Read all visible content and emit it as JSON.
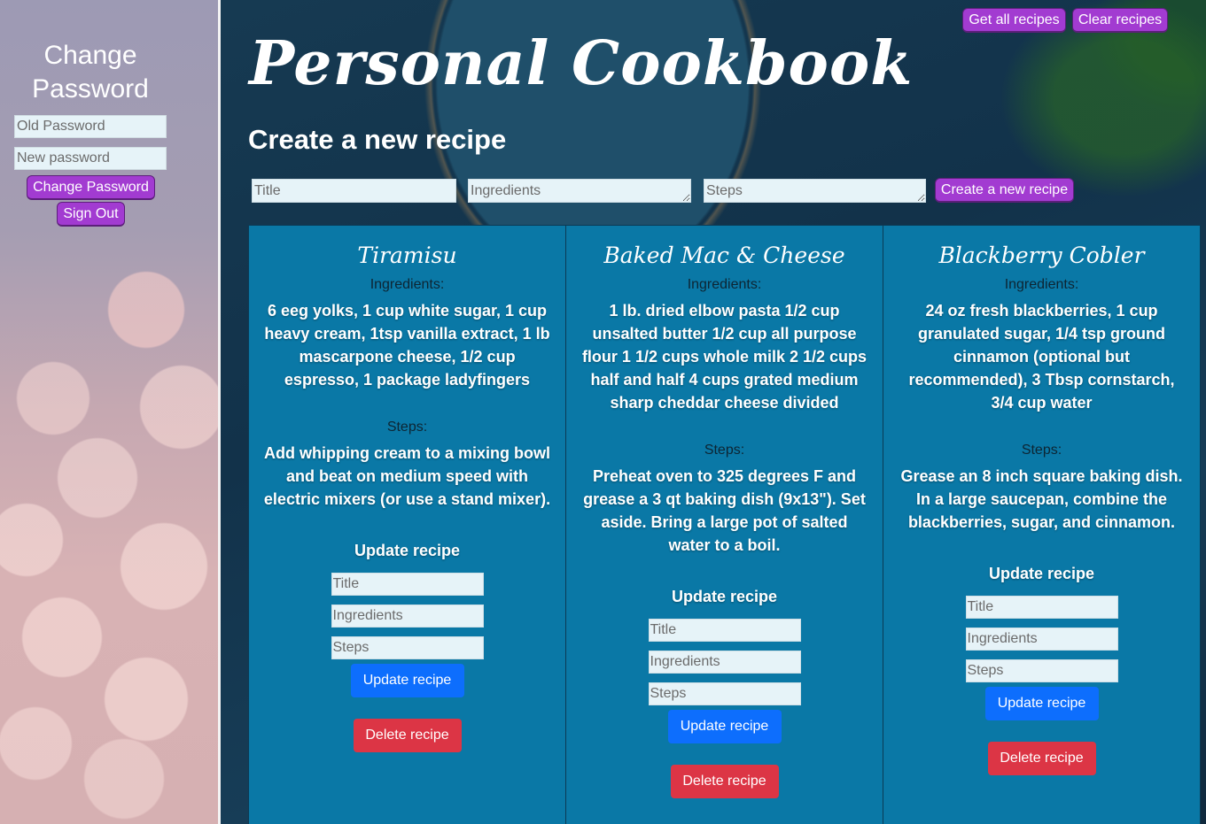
{
  "sidebar": {
    "title": "Change Password",
    "old_password_placeholder": "Old Password",
    "new_password_placeholder": "New password",
    "change_password_label": "Change Password",
    "sign_out_label": "Sign Out"
  },
  "header": {
    "brand": "Personal Cookbook",
    "get_all_label": "Get all recipes",
    "clear_label": "Clear recipes"
  },
  "create": {
    "heading": "Create a new recipe",
    "title_placeholder": "Title",
    "ingredients_placeholder": "Ingredients",
    "steps_placeholder": "Steps",
    "submit_label": "Create a new recipe"
  },
  "recipes": [
    {
      "title": "Tiramisu",
      "ingredients_label": "Ingredients:",
      "ingredients": "6 eeg yolks, 1 cup white sugar, 1 cup heavy cream, 1tsp vanilla extract, 1 lb mascarpone cheese, 1/2 cup espresso, 1 package ladyfingers",
      "steps_label": "Steps:",
      "steps": "Add whipping cream to a mixing bowl and beat on medium speed with electric mixers (or use a stand mixer).",
      "update_heading": "Update recipe",
      "title_placeholder": "Title",
      "ingredients_placeholder": "Ingredients",
      "steps_placeholder": "Steps",
      "update_label": "Update recipe",
      "delete_label": "Delete recipe"
    },
    {
      "title": "Baked Mac & Cheese",
      "ingredients_label": "Ingredients:",
      "ingredients": "1 lb. dried elbow pasta 1/2 cup unsalted butter 1/2 cup all purpose flour 1 1/2 cups whole milk 2 1/2 cups half and half 4 cups grated medium sharp cheddar cheese divided",
      "steps_label": "Steps:",
      "steps": "Preheat oven to 325 degrees F and grease a 3 qt baking dish (9x13\"). Set aside. Bring a large pot of salted water to a boil.",
      "update_heading": "Update recipe",
      "title_placeholder": "Title",
      "ingredients_placeholder": "Ingredients",
      "steps_placeholder": "Steps",
      "update_label": "Update recipe",
      "delete_label": "Delete recipe"
    },
    {
      "title": "Blackberry Cobler",
      "ingredients_label": "Ingredients:",
      "ingredients": "24 oz fresh blackberries, 1 cup granulated sugar, 1/4 tsp ground cinnamon (optional but recommended), 3 Tbsp cornstarch, 3/4 cup water",
      "steps_label": "Steps:",
      "steps": "Grease an 8 inch square baking dish. In a large saucepan, combine the blackberries, sugar, and cinnamon.",
      "update_heading": "Update recipe",
      "title_placeholder": "Title",
      "ingredients_placeholder": "Ingredients",
      "steps_placeholder": "Steps",
      "update_label": "Update recipe",
      "delete_label": "Delete recipe"
    }
  ],
  "colors": {
    "accent_purple": "#a23bd1",
    "card_blue": "#0a78a6",
    "update_blue": "#0d6efd",
    "delete_red": "#dc3545"
  }
}
